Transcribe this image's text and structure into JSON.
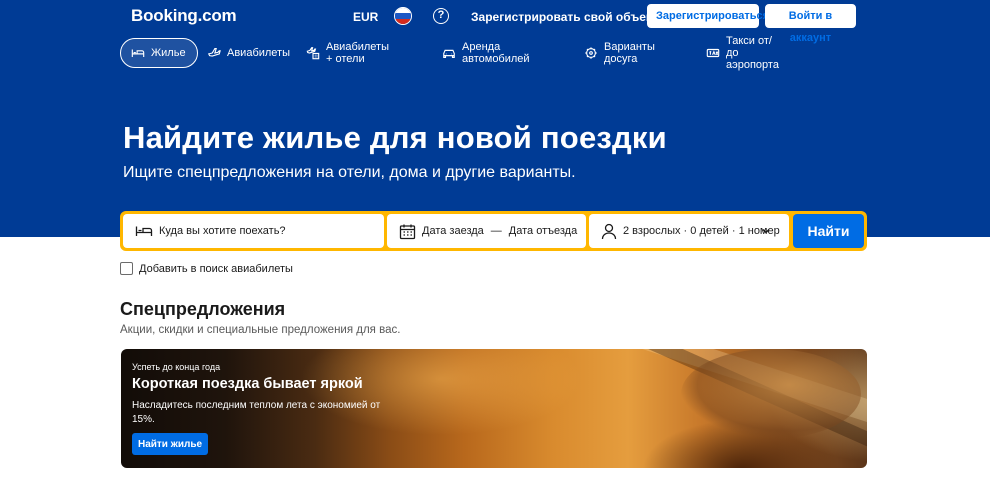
{
  "header": {
    "logo": "Booking.com",
    "currency": "EUR",
    "list_property": "Зарегистрировать свой объект",
    "register": "Зарегистрироваться",
    "sign_in": "Войти в аккаунт"
  },
  "nav": {
    "items": [
      {
        "label": "Жилье",
        "icon": "bed-icon",
        "active": true
      },
      {
        "label": "Авиабилеты",
        "icon": "plane-icon",
        "active": false
      },
      {
        "label": "Авиабилеты + отели",
        "icon": "plane-hotel-icon",
        "active": false
      },
      {
        "label": "Аренда автомобилей",
        "icon": "car-icon",
        "active": false
      },
      {
        "label": "Варианты досуга",
        "icon": "attractions-icon",
        "active": false
      },
      {
        "label": "Такси от/до аэропорта",
        "icon": "taxi-icon",
        "active": false
      }
    ]
  },
  "hero": {
    "title": "Найдите жилье для новой поездки",
    "subtitle": "Ищите спецпредложения на отели, дома и другие варианты."
  },
  "search": {
    "destination_placeholder": "Куда вы хотите поехать?",
    "checkin": "Дата заезда",
    "dash": "—",
    "checkout": "Дата отъезда",
    "guests": "2 взрослых · 0 детей · 1 номер",
    "button": "Найти"
  },
  "flights_checkbox": "Добавить в поиск авиабилеты",
  "deals": {
    "title": "Спецпредложения",
    "subtitle": "Акции, скидки и специальные предложения для вас.",
    "banner": {
      "eyebrow": "Успеть до конца года",
      "title": "Короткая поездка бывает яркой",
      "text": "Насладитесь последним теплом лета с экономией от 15%.",
      "button": "Найти жилье"
    }
  },
  "colors": {
    "brand_blue": "#003b95",
    "action_blue": "#006ce4",
    "search_border": "#ffb700"
  }
}
